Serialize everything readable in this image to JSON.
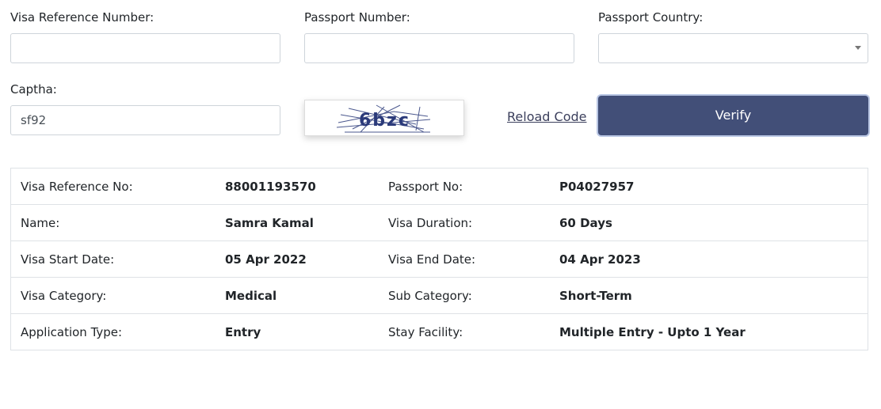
{
  "form": {
    "visa_ref_label": "Visa Reference Number:",
    "visa_ref_value": "",
    "passport_label": "Passport Number:",
    "passport_value": "",
    "country_label": "Passport Country:",
    "country_value": "",
    "captcha_label": "Captha:",
    "captcha_value": "sf92",
    "captcha_image_text": "6bzc",
    "reload_label": "Reload Code",
    "verify_label": "Verify"
  },
  "details": {
    "rows": [
      {
        "k1": "Visa Reference No:",
        "v1": "88001193570",
        "k2": "Passport No:",
        "v2": "P04027957"
      },
      {
        "k1": "Name:",
        "v1": "Samra Kamal",
        "k2": "Visa Duration:",
        "v2": "60 Days"
      },
      {
        "k1": "Visa Start Date:",
        "v1": "05 Apr 2022",
        "k2": "Visa End Date:",
        "v2": "04 Apr 2023"
      },
      {
        "k1": "Visa Category:",
        "v1": "Medical",
        "k2": "Sub Category:",
        "v2": "Short-Term"
      },
      {
        "k1": "Application Type:",
        "v1": "Entry",
        "k2": "Stay Facility:",
        "v2": "Multiple Entry - Upto 1 Year"
      }
    ]
  },
  "colors": {
    "verify_bg": "#424f78",
    "border": "#ced4da"
  }
}
